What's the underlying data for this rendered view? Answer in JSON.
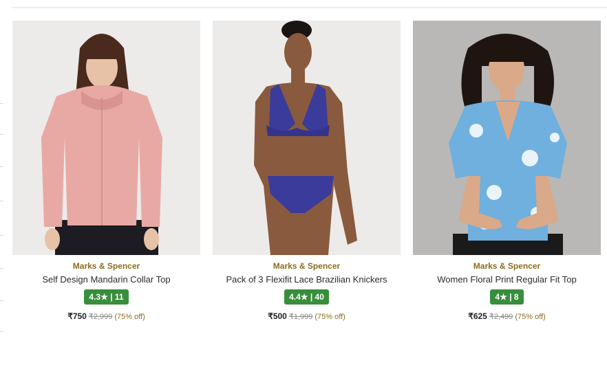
{
  "products": [
    {
      "brand": "Marks & Spencer",
      "title": "Self Design Mandarin Collar Top",
      "rating": "4.3★ | 11",
      "price": "₹750",
      "mrp": "₹2,999",
      "discount": "(75% off)",
      "colors": {
        "bg": "#ecebe9",
        "garment": "#e8a9a4",
        "hair": "#4a2a1c",
        "skin": "#e7c2a6",
        "pants": "#1c1c22"
      }
    },
    {
      "brand": "Marks & Spencer",
      "title": "Pack of 3 Flexifit Lace Brazilian Knickers",
      "rating": "4.4★ | 40",
      "price": "₹500",
      "mrp": "₹1,999",
      "discount": "(75% off)",
      "colors": {
        "bg": "#ecebe9",
        "garment": "#3b3b9b",
        "hair": "#1a1412",
        "skin": "#8a5a3e"
      }
    },
    {
      "brand": "Marks & Spencer",
      "title": "Women Floral Print Regular Fit Top",
      "rating": "4★ | 8",
      "price": "₹625",
      "mrp": "₹2,499",
      "discount": "(75% off)",
      "colors": {
        "bg": "#b9b8b6",
        "garment": "#6fb0de",
        "hair": "#1e1410",
        "skin": "#d9a98a",
        "pants": "#1a1a1a"
      }
    }
  ],
  "theme": {
    "rating_bg": "#388e3c",
    "brand_color": "#8a6d1f"
  }
}
